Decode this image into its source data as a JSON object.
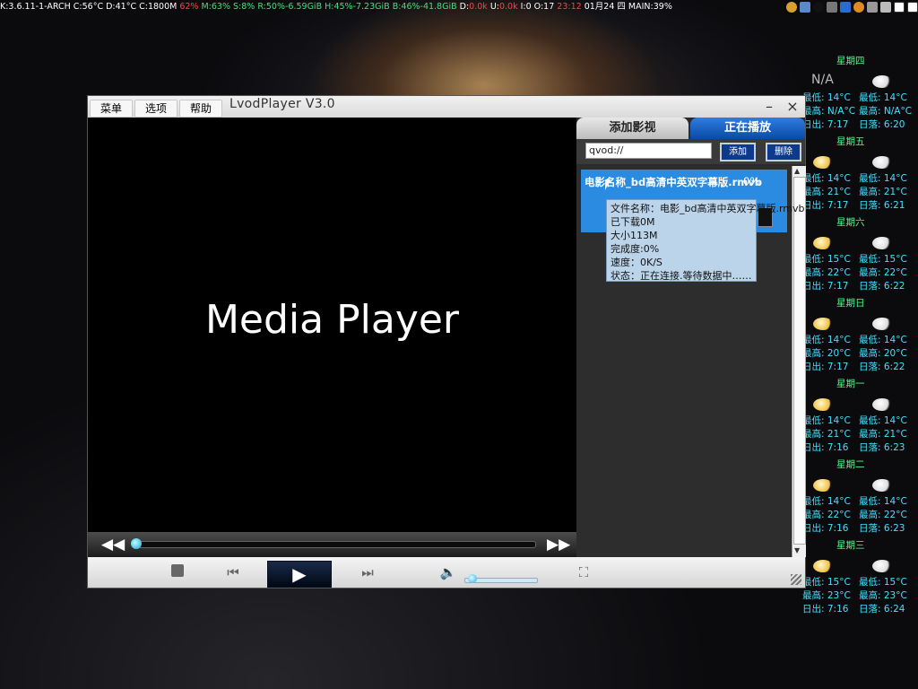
{
  "sysbar": {
    "segments": [
      {
        "text": "K:3.6.11-1-ARCH ",
        "color": "#ffffff"
      },
      {
        "text": "C:56°C ",
        "color": "#ffffff"
      },
      {
        "text": "D:41°C ",
        "color": "#ffffff"
      },
      {
        "text": "C:1800M ",
        "color": "#ffffff"
      },
      {
        "text": "62% ",
        "color": "#ff4040"
      },
      {
        "text": "M:63% ",
        "color": "#40e080"
      },
      {
        "text": "S:8% ",
        "color": "#40e080"
      },
      {
        "text": "R:50%-6.59GiB ",
        "color": "#40e080"
      },
      {
        "text": "H:45%-7.23GiB ",
        "color": "#40e080"
      },
      {
        "text": "B:46%-41.8GiB ",
        "color": "#40e080"
      },
      {
        "text": "D:",
        "color": "#ffffff"
      },
      {
        "text": "0.0k ",
        "color": "#ff4040"
      },
      {
        "text": "U:",
        "color": "#ffffff"
      },
      {
        "text": "0.0k ",
        "color": "#ff4040"
      },
      {
        "text": "I:0 O:17 ",
        "color": "#ffffff"
      },
      {
        "text": "23:12 ",
        "color": "#ff4040"
      },
      {
        "text": "01月24 四 ",
        "color": "#ffffff"
      },
      {
        "text": "MAIN:39%",
        "color": "#ffffff"
      }
    ]
  },
  "weather": {
    "days": [
      {
        "day": "星期四",
        "today": "N/A",
        "a_low": "最低: 14°C",
        "a_high": "最高: N/A°C",
        "a_rise": "日出: 7:17",
        "b_low": "最低: 14°C",
        "b_high": "最高: N/A°C",
        "b_set": "日落: 6:20"
      },
      {
        "day": "星期五",
        "a_low": "最低: 14°C",
        "a_high": "最高: 21°C",
        "a_rise": "日出: 7:17",
        "b_low": "最低: 14°C",
        "b_high": "最高: 21°C",
        "b_set": "日落: 6:21"
      },
      {
        "day": "星期六",
        "a_low": "最低: 15°C",
        "a_high": "最高: 22°C",
        "a_rise": "日出: 7:17",
        "b_low": "最低: 15°C",
        "b_high": "最高: 22°C",
        "b_set": "日落: 6:22"
      },
      {
        "day": "星期日",
        "a_low": "最低: 14°C",
        "a_high": "最高: 20°C",
        "a_rise": "日出: 7:17",
        "b_low": "最低: 14°C",
        "b_high": "最高: 20°C",
        "b_set": "日落: 6:22"
      },
      {
        "day": "星期一",
        "a_low": "最低: 14°C",
        "a_high": "最高: 21°C",
        "a_rise": "日出: 7:16",
        "b_low": "最低: 14°C",
        "b_high": "最高: 21°C",
        "b_set": "日落: 6:23"
      },
      {
        "day": "星期二",
        "a_low": "最低: 14°C",
        "a_high": "最高: 22°C",
        "a_rise": "日出: 7:16",
        "b_low": "最低: 14°C",
        "b_high": "最高: 22°C",
        "b_set": "日落: 6:23"
      },
      {
        "day": "星期三",
        "a_low": "最低: 15°C",
        "a_high": "最高: 23°C",
        "a_rise": "日出: 7:16",
        "b_low": "最低: 15°C",
        "b_high": "最高: 23°C",
        "b_set": "日落: 6:24"
      }
    ]
  },
  "window": {
    "title": "LvodPlayer V3.0",
    "menu": [
      "菜单",
      "选项",
      "帮助"
    ],
    "minimize_glyph": "–",
    "close_glyph": "×",
    "video_label": "Media Player"
  },
  "seek": {
    "rewind_glyph": "◀◀",
    "forward_glyph": "▶▶",
    "progress": 0.0
  },
  "controls": {
    "stop_icon": "stop-icon",
    "prev_glyph": "⏮",
    "play_glyph": "▶",
    "next_glyph": "⏭",
    "volume_glyph": "🔈",
    "fullscreen_glyph": "⛶",
    "volume_level": 0.05
  },
  "side": {
    "tab_add": "添加影视",
    "tab_playing": "正在播放",
    "url_value": "qvod://",
    "btn_add": "添加",
    "btn_del": "删除",
    "item": {
      "name": "电影名称_bd高清中英双字幕版.rmvb",
      "percent": "0%"
    },
    "tooltip": [
      "文件名称：电影_bd高清中英双字幕版.rmvb",
      "已下载0M",
      "大小113M",
      "完成度:0%",
      "速度：0K/S",
      "状态：正在连接.等待数据中……"
    ]
  }
}
